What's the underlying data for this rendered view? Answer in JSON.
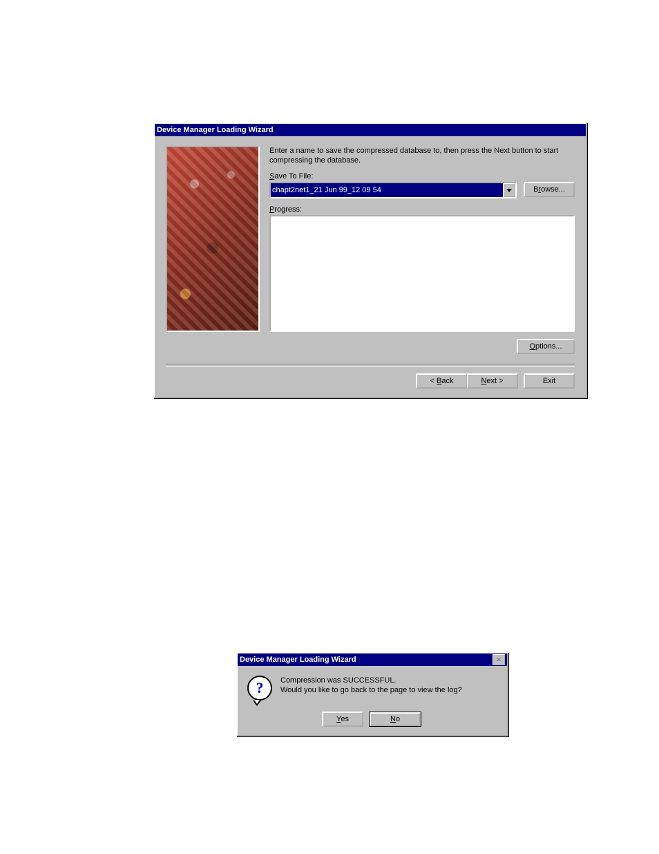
{
  "wizard": {
    "title": "Device Manager Loading Wizard",
    "instructions": "Enter a name to save the compressed database to, then press the Next button to start compressing the database.",
    "save_label_pre": "S",
    "save_label_post": "ave To File:",
    "file_value": "chapt2net1_21 Jun 99_12 09 54",
    "browse_pre": "B",
    "browse_u": "r",
    "browse_post": "owse...",
    "progress_pre": "P",
    "progress_post": "rogress:",
    "options_pre": "O",
    "options_post": "ptions...",
    "back_pre": "< ",
    "back_u": "B",
    "back_post": "ack",
    "next_u": "N",
    "next_post": "ext >",
    "exit": "Exit"
  },
  "msgbox": {
    "title": "Device Manager Loading Wizard",
    "line1": "Compression was SUCCESSFUL.",
    "line2": "Would you like to go back to the page to view the log?",
    "yes_u": "Y",
    "yes_post": "es",
    "no_u": "N",
    "no_post": "o"
  }
}
